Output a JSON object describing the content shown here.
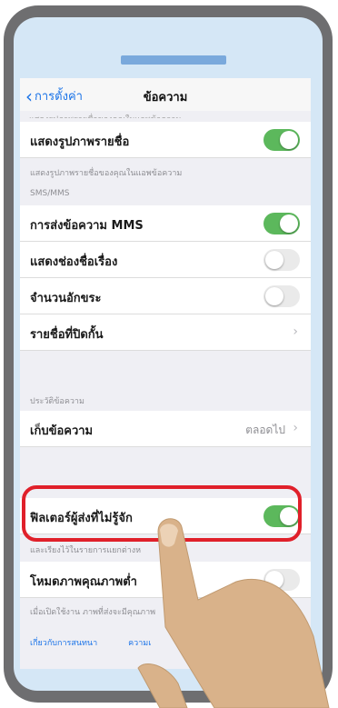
{
  "nav": {
    "back_label": "การตั้งค่า",
    "title": "ข้อความ"
  },
  "partial_text": "แสดงรูปภาพรายชื่อของคุณในแอพข้อความ",
  "rows": {
    "contact_photos": {
      "label": "แสดงรูปภาพรายชื่อ",
      "toggle": "on"
    },
    "mms": {
      "label": "การส่งข้อความ MMS",
      "toggle": "on"
    },
    "subject": {
      "label": "แสดงช่องชื่อเรื่อง",
      "toggle": "off"
    },
    "char_count": {
      "label": "จำนวนอักขระ",
      "toggle": "off"
    },
    "blocked": {
      "label": "รายชื่อที่ปิดกั้น"
    },
    "keep_messages": {
      "label": "เก็บข้อความ",
      "value": "ตลอดไป"
    },
    "filter_unknown": {
      "label": "ฟิลเตอร์ผู้ส่งที่ไม่รู้จัก",
      "toggle": "on"
    },
    "low_quality": {
      "label": "โหมดภาพคุณภาพต่ำ",
      "toggle": "off"
    }
  },
  "notes": {
    "contact_photos_note": "แสดงรูปภาพรายชื่อของคุณในแอพข้อความ",
    "sms_mms_header": "SMS/MMS",
    "history_header": "ประวัติข้อความ",
    "filter_note": "และเรียงไว้ในรายการแยกต่างห",
    "low_quality_note": "เมื่อเปิดใช้งาน ภาพที่ส่งจะมีคุณภาพ",
    "privacy_link": "เกี่ยวกับการสนทนา",
    "privacy_link_tail": "ความเ"
  },
  "colors": {
    "toggle_on": "#5cb85c",
    "accent": "#1a73e8",
    "highlight": "#e0202a",
    "frame": "#6e6e70",
    "screen_bg": "#d5e7f6"
  },
  "icons": {
    "back": "chevron-left-icon",
    "disclosure": "chevron-right-icon",
    "hand": "pointing-hand-icon"
  }
}
